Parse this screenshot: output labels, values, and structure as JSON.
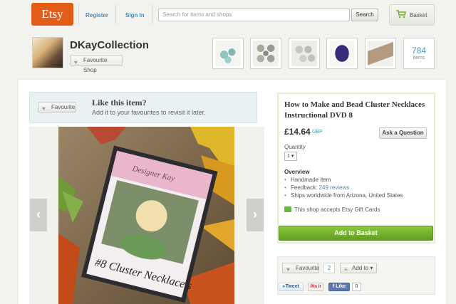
{
  "header": {
    "logo": "Etsy",
    "register": "Register",
    "sign_in": "Sign In",
    "search_placeholder": "Search for items and shops",
    "search_button": "Search",
    "basket": "Basket"
  },
  "shop": {
    "name": "DKayCollection",
    "favourite_shop": "Favourite Shop",
    "item_count": "784",
    "item_count_label": "items"
  },
  "favourite_banner": {
    "button": "Favourite",
    "title": "Like this item?",
    "subtitle": "Add it to your favourites to revisit it later."
  },
  "listing": {
    "title": "How to Make and Bead Cluster Necklaces Instructional DVD 8",
    "price": "£14.64",
    "currency": "GBP",
    "ask_question": "Ask a Question",
    "quantity_label": "Quantity",
    "quantity_value": "1",
    "overview_heading": "Overview",
    "overview": [
      {
        "text": "Handmade item"
      },
      {
        "prefix": "Feedback: ",
        "link": "249 reviews"
      },
      {
        "text": "Ships worldwide from Arizona, United States"
      }
    ],
    "gift_cards": "This shop accepts Etsy Gift Cards",
    "add_to_basket": "Add to Basket"
  },
  "photo": {
    "cover_top_text": "Designer Kay",
    "cover_bottom_text": "#8 Cluster Necklace's"
  },
  "social": {
    "favourite": "Favourite",
    "favourite_count": "2",
    "add_to": "Add to",
    "tweet": "Tweet",
    "pin_it": "Pin it",
    "like": "Like",
    "like_count": "0"
  },
  "colors": {
    "etsy_orange": "#e25d18",
    "add_to_basket_green": "#6eb32b",
    "link_blue": "#4a8bb4"
  }
}
